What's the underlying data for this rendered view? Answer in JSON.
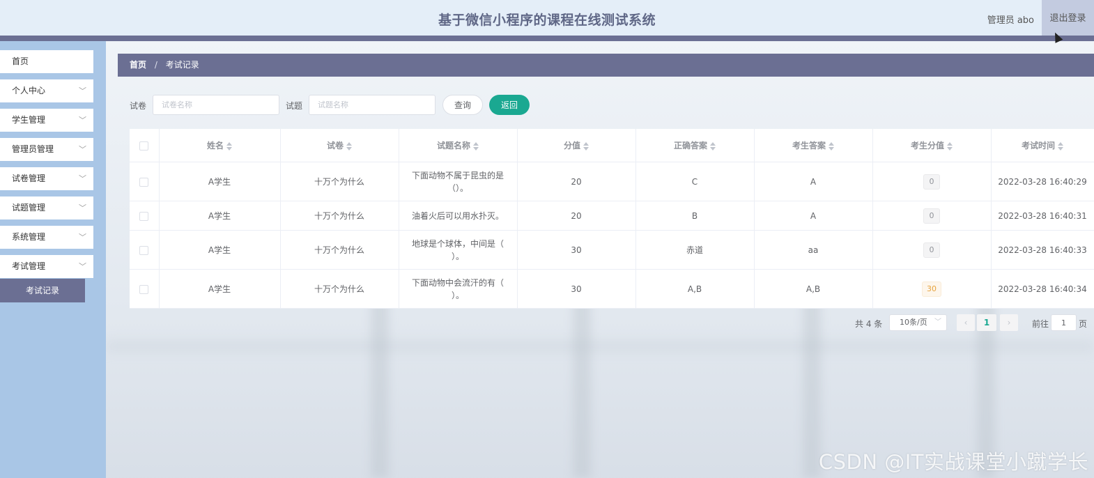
{
  "header": {
    "title": "基于微信小程序的课程在线测试系统",
    "user": "管理员 abo",
    "logout": "退出登录"
  },
  "sidebar": {
    "items": [
      {
        "label": "首页",
        "expandable": false
      },
      {
        "label": "个人中心",
        "expandable": true
      },
      {
        "label": "学生管理",
        "expandable": true
      },
      {
        "label": "管理员管理",
        "expandable": true
      },
      {
        "label": "试卷管理",
        "expandable": true
      },
      {
        "label": "试题管理",
        "expandable": true
      },
      {
        "label": "系统管理",
        "expandable": true
      },
      {
        "label": "考试管理",
        "expandable": true
      }
    ],
    "active_sub": "考试记录"
  },
  "breadcrumb": {
    "home": "首页",
    "separator": "/",
    "current": "考试记录"
  },
  "search": {
    "paper_label": "试卷",
    "paper_placeholder": "试卷名称",
    "question_label": "试题",
    "question_placeholder": "试题名称",
    "query_button": "查询",
    "back_button": "返回"
  },
  "table": {
    "headers": [
      "姓名",
      "试卷",
      "试题名称",
      "分值",
      "正确答案",
      "考生答案",
      "考生分值",
      "考试时间"
    ],
    "rows": [
      {
        "name": "A学生",
        "paper": "十万个为什么",
        "question": "下面动物不属于昆虫的是（）。",
        "score": "20",
        "correct": "C",
        "answer": "A",
        "student_score": "0",
        "time": "2022-03-28 16:40:29"
      },
      {
        "name": "A学生",
        "paper": "十万个为什么",
        "question": "油着火后可以用水扑灭。",
        "score": "20",
        "correct": "B",
        "answer": "A",
        "student_score": "0",
        "time": "2022-03-28 16:40:31"
      },
      {
        "name": "A学生",
        "paper": "十万个为什么",
        "question": "地球是个球体，中间是（ ）。",
        "score": "30",
        "correct": "赤道",
        "answer": "aa",
        "student_score": "0",
        "time": "2022-03-28 16:40:33"
      },
      {
        "name": "A学生",
        "paper": "十万个为什么",
        "question": "下面动物中会流汗的有（ ）。",
        "score": "30",
        "correct": "A,B",
        "answer": "A,B",
        "student_score": "30",
        "time": "2022-03-28 16:40:34"
      }
    ]
  },
  "pagination": {
    "total": "共 4 条",
    "page_size": "10条/页",
    "prev": "‹",
    "current": "1",
    "next": "›",
    "goto_label": "前往",
    "goto_value": "1",
    "goto_suffix": "页"
  },
  "watermark": "CSDN @IT实战课堂小蹴学长",
  "colors": {
    "accent": "#6b6f93",
    "primary_button": "#1aa891",
    "sidebar_bg": "#a9c6e6",
    "header_bg": "#e4eef8"
  }
}
